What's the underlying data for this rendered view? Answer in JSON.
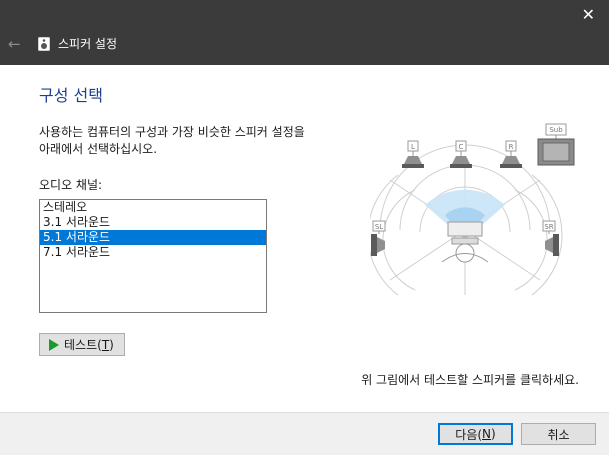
{
  "window": {
    "title": "스피커 설정",
    "close_glyph": "✕",
    "back_glyph": "←"
  },
  "page": {
    "heading": "구성 선택",
    "description_lines": [
      "사용하는 컴퓨터의 구성과 가장 비슷한 스피커 설정을",
      "아래에서 선택하십시오."
    ]
  },
  "channels": {
    "label": "오디오 채널:",
    "items": [
      "스테레오",
      "3.1 서라운드",
      "5.1 서라운드",
      "7.1 서라운드"
    ],
    "selected": "5.1 서라운드"
  },
  "test_button": {
    "label": "테스트(",
    "mnemonic": "T",
    "suffix": ")"
  },
  "speakers": {
    "L": "L",
    "C": "C",
    "R": "R",
    "Sub": "Sub",
    "SL": "SL",
    "SR": "SR"
  },
  "hint": "위 그림에서 테스트할 스피커를 클릭하세요.",
  "footer": {
    "next": {
      "label": "다음(",
      "mnemonic": "N",
      "suffix": ")"
    },
    "cancel": "취소"
  },
  "colors": {
    "titlebar": "#3b3b3b",
    "accent": "#0078d7",
    "heading": "#1e3f8f",
    "play": "#1a9a28"
  }
}
